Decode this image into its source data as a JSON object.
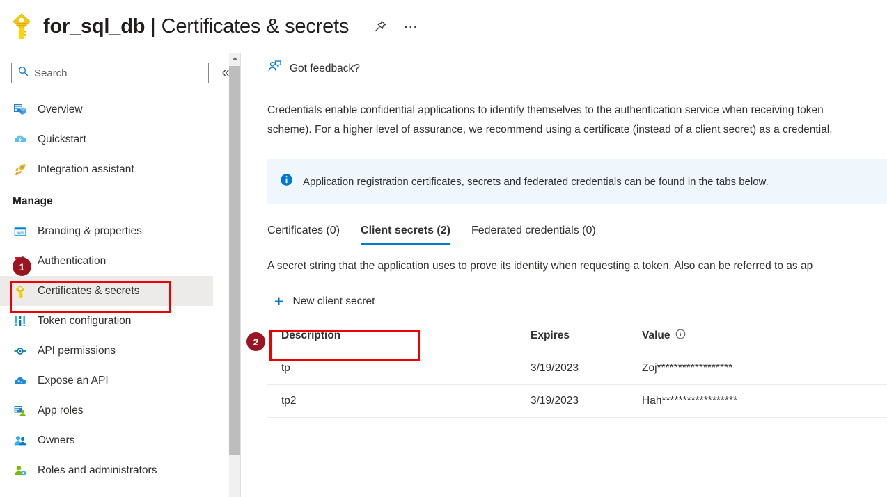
{
  "header": {
    "icon": "key-icon",
    "resource_name": "for_sql_db",
    "separator": "|",
    "page_section": "Certificates & secrets",
    "pin_icon": "pin-icon",
    "more_icon": "ellipsis-icon"
  },
  "sidebar": {
    "search": {
      "placeholder": "Search",
      "value": "",
      "icon": "search-icon"
    },
    "collapse_icon": "chevron-double-left-icon",
    "items": [
      {
        "label": "Overview",
        "icon": "overview-icon",
        "selected": false
      },
      {
        "label": "Quickstart",
        "icon": "quickstart-cloud-icon",
        "selected": false
      },
      {
        "label": "Integration assistant",
        "icon": "rocket-icon",
        "selected": false
      }
    ],
    "group_label": "Manage",
    "manage_items": [
      {
        "label": "Branding & properties",
        "icon": "branding-icon",
        "selected": false
      },
      {
        "label": "Authentication",
        "icon": "authentication-icon",
        "selected": false
      },
      {
        "label": "Certificates & secrets",
        "icon": "key-icon",
        "selected": true
      },
      {
        "label": "Token configuration",
        "icon": "token-icon",
        "selected": false
      },
      {
        "label": "API permissions",
        "icon": "api-permissions-icon",
        "selected": false
      },
      {
        "label": "Expose an API",
        "icon": "expose-api-icon",
        "selected": false
      },
      {
        "label": "App roles",
        "icon": "app-roles-icon",
        "selected": false
      },
      {
        "label": "Owners",
        "icon": "owners-icon",
        "selected": false
      },
      {
        "label": "Roles and administrators",
        "icon": "roles-admins-icon",
        "selected": false
      }
    ],
    "scroll_up_icon": "scroll-up-arrow-icon"
  },
  "annotations": {
    "marker_1": "1",
    "marker_2": "2",
    "highlight_color": "#ee0000",
    "marker_color": "#9b1420"
  },
  "main": {
    "feedback": {
      "label": "Got feedback?",
      "icon": "feedback-person-icon"
    },
    "description": "Credentials enable confidential applications to identify themselves to the authentication service when receiving token\nscheme). For a higher level of assurance, we recommend using a certificate (instead of a client secret) as a credential.",
    "info_bar": {
      "icon": "info-circle-icon",
      "text": "Application registration certificates, secrets and federated credentials can be found in the tabs below.",
      "background": "#eff6fc",
      "accent": "#0078d4"
    },
    "tabs": [
      {
        "label": "Certificates (0)",
        "active": false
      },
      {
        "label": "Client secrets (2)",
        "active": true
      },
      {
        "label": "Federated credentials (0)",
        "active": false
      }
    ],
    "tab_accent": "#0078d4",
    "sub_description": "A secret string that the application uses to prove its identity when requesting a token. Also can be referred to as ap",
    "new_secret_button": {
      "label": "New client secret",
      "icon": "plus-icon",
      "icon_color": "#0078d4"
    },
    "table": {
      "columns": [
        "Description",
        "Expires",
        "Value"
      ],
      "value_info_icon": "info-outline-icon",
      "rows": [
        {
          "description": "tp",
          "expires": "3/19/2023",
          "value": "Zoj******************"
        },
        {
          "description": "tp2",
          "expires": "3/19/2023",
          "value": "Hah******************"
        }
      ]
    }
  }
}
